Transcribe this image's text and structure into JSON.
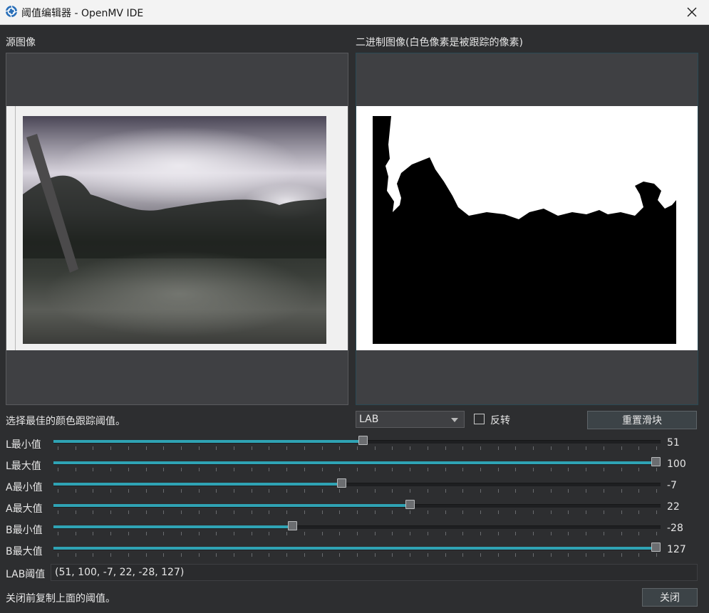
{
  "window": {
    "title": "阈值编辑器 - OpenMV IDE",
    "app_icon": "openmv-logo-icon",
    "close_icon": "close-icon"
  },
  "source": {
    "label": "源图像"
  },
  "binary": {
    "label": "二进制图像(白色像素是被跟踪的像素)"
  },
  "instructions": "选择最佳的颜色跟踪阈值。",
  "colorspace": {
    "selected": "LAB"
  },
  "invert": {
    "label": "反转",
    "checked": false
  },
  "reset_button": "重置滑块",
  "sliders": [
    {
      "label": "L最小值",
      "value": "51",
      "min": 0,
      "max": 100,
      "pos": 51
    },
    {
      "label": "L最大值",
      "value": "100",
      "min": 0,
      "max": 100,
      "pos": 100
    },
    {
      "label": "A最小值",
      "value": "-7",
      "min": -128,
      "max": 127,
      "pos": -7
    },
    {
      "label": "A最大值",
      "value": "22",
      "min": -128,
      "max": 127,
      "pos": 22
    },
    {
      "label": "B最小值",
      "value": "-28",
      "min": -128,
      "max": 127,
      "pos": -28
    },
    {
      "label": "B最大值",
      "value": "127",
      "min": -128,
      "max": 127,
      "pos": 127
    }
  ],
  "lab_threshold": {
    "label": "LAB阈值",
    "value": "(51, 100, -7, 22, -28, 127)"
  },
  "footer": {
    "note": "关闭前复制上面的阈值。",
    "close_button": "关闭"
  },
  "colors": {
    "accent": "#2fa3b4",
    "background": "#2d2e30",
    "panel": "#3f4043"
  }
}
